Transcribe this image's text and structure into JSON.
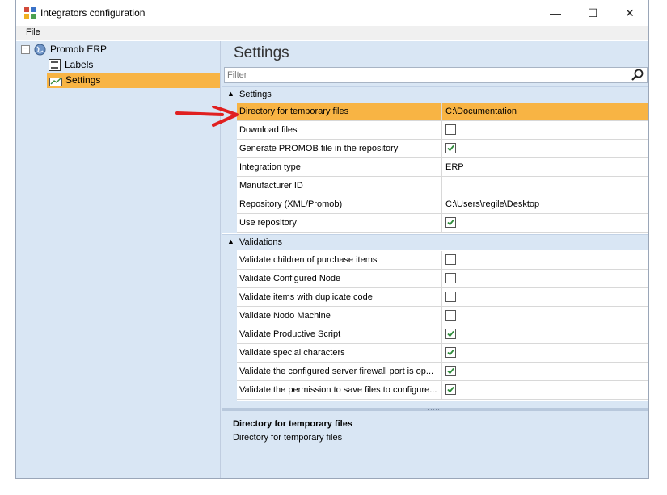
{
  "window": {
    "title": "Integrators configuration",
    "controls": {
      "minimize": "—",
      "maximize": "☐",
      "close": "✕"
    }
  },
  "menu": {
    "file": "File"
  },
  "tree": {
    "root": {
      "label": "Promob ERP",
      "icon": "globe-icon",
      "expanded": true
    },
    "items": [
      {
        "label": "Labels",
        "icon": "labels-icon",
        "selected": false
      },
      {
        "label": "Settings",
        "icon": "settings-chart-icon",
        "selected": true
      }
    ]
  },
  "panel": {
    "heading": "Settings",
    "filter_placeholder": "Filter",
    "categories": [
      {
        "label": "Settings",
        "rows": [
          {
            "name": "Directory for temporary files",
            "value": "C:\\Documentation",
            "selected": true
          },
          {
            "name": "Download files",
            "checked": false
          },
          {
            "name": "Generate PROMOB file in the repository",
            "checked": true
          },
          {
            "name": "Integration type",
            "value": "ERP"
          },
          {
            "name": "Manufacturer ID",
            "value": ""
          },
          {
            "name": "Repository (XML/Promob)",
            "value": "C:\\Users\\regile\\Desktop"
          },
          {
            "name": "Use repository",
            "checked": true
          }
        ]
      },
      {
        "label": "Validations",
        "rows": [
          {
            "name": "Validate children of purchase items",
            "checked": false
          },
          {
            "name": "Validate Configured Node",
            "checked": false
          },
          {
            "name": "Validate items with duplicate code",
            "checked": false
          },
          {
            "name": "Validate Nodo Machine",
            "checked": false
          },
          {
            "name": "Validate Productive Script",
            "checked": true
          },
          {
            "name": "Validate special characters",
            "checked": true
          },
          {
            "name": "Validate the configured server firewall port is op...",
            "checked": true
          },
          {
            "name": "Validate the permission to save files to configure...",
            "checked": true
          }
        ]
      }
    ],
    "help": {
      "title": "Directory for temporary files",
      "description": "Directory for temporary files"
    }
  },
  "colors": {
    "selection": "#f8b444",
    "panel_background": "#d9e6f4",
    "checkmark": "#2e8b3a",
    "annotation_arrow": "#e02020"
  }
}
